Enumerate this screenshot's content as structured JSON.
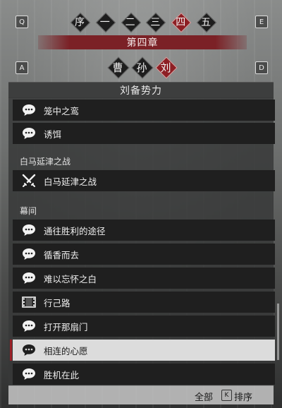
{
  "keys": {
    "prev_chapter": "Q",
    "next_chapter": "E",
    "prev_faction": "A",
    "next_faction": "D"
  },
  "chapters": [
    {
      "label": "序",
      "active": false
    },
    {
      "label": "一",
      "active": false
    },
    {
      "label": "二",
      "active": false
    },
    {
      "label": "三",
      "active": false
    },
    {
      "label": "四",
      "active": true
    },
    {
      "label": "五",
      "active": false
    }
  ],
  "chapter_title": "第四章",
  "factions": [
    {
      "label": "曹",
      "active": false
    },
    {
      "label": "孙",
      "active": false
    },
    {
      "label": "刘",
      "active": true
    }
  ],
  "panel_title": "刘备势力",
  "items_top": [
    {
      "label": "笼中之鸾",
      "icon": "speech-bubble-icon"
    },
    {
      "label": "诱饵",
      "icon": "speech-bubble-icon"
    }
  ],
  "section_battle": "白马延津之战",
  "items_battle": [
    {
      "label": "白马延津之战",
      "icon": "crossed-swords-icon"
    }
  ],
  "section_interlude": "幕间",
  "items_interlude": [
    {
      "label": "通往胜利的途径",
      "icon": "speech-bubble-icon"
    },
    {
      "label": "循香而去",
      "icon": "speech-bubble-icon"
    },
    {
      "label": "难以忘怀之白",
      "icon": "speech-bubble-icon"
    },
    {
      "label": "行己路",
      "icon": "film-strip-icon"
    },
    {
      "label": "打开那扇门",
      "icon": "speech-bubble-icon"
    },
    {
      "label": "相连的心愿",
      "icon": "speech-bubble-icon",
      "selected": true
    },
    {
      "label": "胜机在此",
      "icon": "speech-bubble-icon"
    }
  ],
  "bottom": {
    "filter_label": "全部",
    "sort_key": "K",
    "sort_label": "排序"
  }
}
